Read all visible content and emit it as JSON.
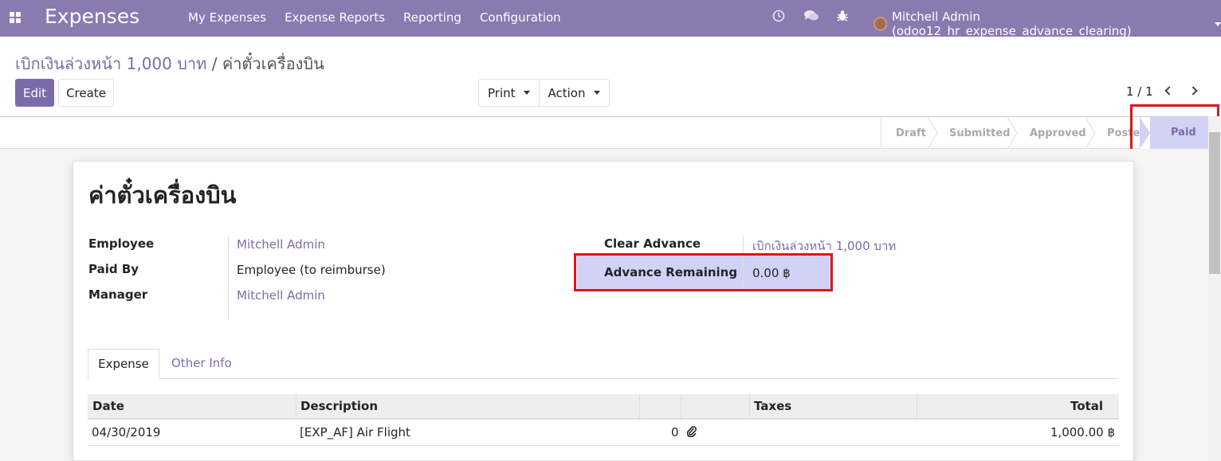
{
  "navbar": {
    "brand": "Expenses",
    "menu": [
      "My Expenses",
      "Expense Reports",
      "Reporting",
      "Configuration"
    ],
    "icons": [
      "clock-icon",
      "chat-icon",
      "bug-icon"
    ],
    "user": "Mitchell Admin (odoo12_hr_expense_advance_clearing)"
  },
  "breadcrumb": {
    "parent": "เบิกเงินล่วงหน้า 1,000 บาท",
    "separator": "/",
    "current": "ค่าตั๋วเครื่องบิน"
  },
  "buttons": {
    "edit": "Edit",
    "create": "Create",
    "print": "Print",
    "action": "Action"
  },
  "pager": {
    "value": "1 / 1"
  },
  "statusbar": {
    "stages": [
      "Draft",
      "Submitted",
      "Approved",
      "Posted",
      "Paid"
    ],
    "active": "Paid"
  },
  "record": {
    "title": "ค่าตั๋วเครื่องบิน",
    "employee_label": "Employee",
    "employee": "Mitchell Admin",
    "paid_by_label": "Paid By",
    "paid_by": "Employee (to reimburse)",
    "manager_label": "Manager",
    "manager": "Mitchell Admin",
    "clear_advance_label": "Clear Advance",
    "clear_advance": "เบิกเงินล่วงหน้า 1,000 บาท",
    "advance_remaining_label": "Advance Remaining",
    "advance_remaining": "0.00 ฿"
  },
  "tabs": [
    "Expense",
    "Other Info"
  ],
  "table": {
    "headers": [
      "Date",
      "Description",
      "",
      "",
      "Taxes",
      "Total"
    ],
    "rows": [
      {
        "date": "04/30/2019",
        "description": "[EXP_AF] Air Flight",
        "qty": "0",
        "attachment": "paperclip-icon",
        "taxes": "",
        "total": "1,000.00 ฿"
      }
    ]
  },
  "colors": {
    "navbar": "#8a7ab0",
    "primary": "#7c6bab",
    "highlight": "#d2d2f6",
    "annotation_red": "#e0131b"
  }
}
